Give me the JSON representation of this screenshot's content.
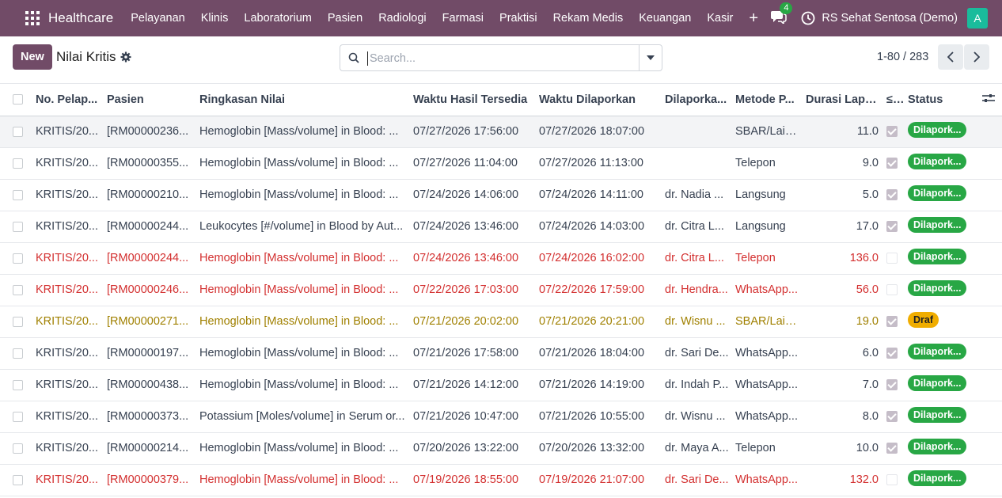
{
  "navbar": {
    "brand": "Healthcare",
    "menu": [
      "Pelayanan",
      "Klinis",
      "Laboratorium",
      "Pasien",
      "Radiologi",
      "Farmasi",
      "Praktisi",
      "Rekam Medis",
      "Keuangan",
      "Kasir"
    ],
    "plus": "+",
    "chat_count": "4",
    "company": "RS Sehat Sentosa (Demo)",
    "avatar_letter": "A",
    "colors": {
      "bar": "#714B67",
      "avatar": "#1ABC9C",
      "badge": "#28a745"
    }
  },
  "control": {
    "new_label": "New",
    "title": "Nilai Kritis",
    "search_placeholder": "Search...",
    "pager": "1-80 / 283"
  },
  "table": {
    "columns": [
      "No. Pelap...",
      "Pasien",
      "Ringkasan Nilai",
      "Waktu Hasil Tersedia",
      "Waktu Dilaporkan",
      "Dilaporka...",
      "Metode P...",
      "Durasi Lapo...",
      "≤...",
      "Status"
    ],
    "rows": [
      {
        "no": "KRITIS/20...",
        "pasien": "[RM00000236...",
        "ringkasan": "Hemoglobin [Mass/volume] in Blood: ...",
        "tersedia": "07/27/2026 17:56:00",
        "dilaporkan": "07/27/2026 18:07:00",
        "oleh": "",
        "metode": "SBAR/Lain...",
        "durasi": "11.0",
        "ok": true,
        "status": "Dilapork...",
        "tone": "normal",
        "status_kind": "green"
      },
      {
        "no": "KRITIS/20...",
        "pasien": "[RM00000355...",
        "ringkasan": "Hemoglobin [Mass/volume] in Blood: ...",
        "tersedia": "07/27/2026 11:04:00",
        "dilaporkan": "07/27/2026 11:13:00",
        "oleh": "",
        "metode": "Telepon",
        "durasi": "9.0",
        "ok": true,
        "status": "Dilapork...",
        "tone": "normal",
        "status_kind": "green"
      },
      {
        "no": "KRITIS/20...",
        "pasien": "[RM00000210...",
        "ringkasan": "Hemoglobin [Mass/volume] in Blood: ...",
        "tersedia": "07/24/2026 14:06:00",
        "dilaporkan": "07/24/2026 14:11:00",
        "oleh": "dr. Nadia ...",
        "metode": "Langsung",
        "durasi": "5.0",
        "ok": true,
        "status": "Dilapork...",
        "tone": "normal",
        "status_kind": "green"
      },
      {
        "no": "KRITIS/20...",
        "pasien": "[RM00000244...",
        "ringkasan": "Leukocytes [#/volume] in Blood by Aut...",
        "tersedia": "07/24/2026 13:46:00",
        "dilaporkan": "07/24/2026 14:03:00",
        "oleh": "dr. Citra L...",
        "metode": "Langsung",
        "durasi": "17.0",
        "ok": true,
        "status": "Dilapork...",
        "tone": "normal",
        "status_kind": "green"
      },
      {
        "no": "KRITIS/20...",
        "pasien": "[RM00000244...",
        "ringkasan": "Hemoglobin [Mass/volume] in Blood: ...",
        "tersedia": "07/24/2026 13:46:00",
        "dilaporkan": "07/24/2026 16:02:00",
        "oleh": "dr. Citra L...",
        "metode": "Telepon",
        "durasi": "136.0",
        "ok": false,
        "status": "Dilapork...",
        "tone": "red",
        "status_kind": "green"
      },
      {
        "no": "KRITIS/20...",
        "pasien": "[RM00000246...",
        "ringkasan": "Hemoglobin [Mass/volume] in Blood: ...",
        "tersedia": "07/22/2026 17:03:00",
        "dilaporkan": "07/22/2026 17:59:00",
        "oleh": "dr. Hendra...",
        "metode": "WhatsApp...",
        "durasi": "56.0",
        "ok": false,
        "status": "Dilapork...",
        "tone": "red",
        "status_kind": "green"
      },
      {
        "no": "KRITIS/20...",
        "pasien": "[RM00000271...",
        "ringkasan": "Hemoglobin [Mass/volume] in Blood: ...",
        "tersedia": "07/21/2026 20:02:00",
        "dilaporkan": "07/21/2026 20:21:00",
        "oleh": "dr. Wisnu ...",
        "metode": "SBAR/Lain...",
        "durasi": "19.0",
        "ok": true,
        "status": "Draf",
        "tone": "yellow",
        "status_kind": "orange"
      },
      {
        "no": "KRITIS/20...",
        "pasien": "[RM00000197...",
        "ringkasan": "Hemoglobin [Mass/volume] in Blood: ...",
        "tersedia": "07/21/2026 17:58:00",
        "dilaporkan": "07/21/2026 18:04:00",
        "oleh": "dr. Sari De...",
        "metode": "WhatsApp...",
        "durasi": "6.0",
        "ok": true,
        "status": "Dilapork...",
        "tone": "normal",
        "status_kind": "green"
      },
      {
        "no": "KRITIS/20...",
        "pasien": "[RM00000438...",
        "ringkasan": "Hemoglobin [Mass/volume] in Blood: ...",
        "tersedia": "07/21/2026 14:12:00",
        "dilaporkan": "07/21/2026 14:19:00",
        "oleh": "dr. Indah P...",
        "metode": "WhatsApp...",
        "durasi": "7.0",
        "ok": true,
        "status": "Dilapork...",
        "tone": "normal",
        "status_kind": "green"
      },
      {
        "no": "KRITIS/20...",
        "pasien": "[RM00000373...",
        "ringkasan": "Potassium [Moles/volume] in Serum or...",
        "tersedia": "07/21/2026 10:47:00",
        "dilaporkan": "07/21/2026 10:55:00",
        "oleh": "dr. Wisnu ...",
        "metode": "WhatsApp...",
        "durasi": "8.0",
        "ok": true,
        "status": "Dilapork...",
        "tone": "normal",
        "status_kind": "green"
      },
      {
        "no": "KRITIS/20...",
        "pasien": "[RM00000214...",
        "ringkasan": "Hemoglobin [Mass/volume] in Blood: ...",
        "tersedia": "07/20/2026 13:22:00",
        "dilaporkan": "07/20/2026 13:32:00",
        "oleh": "dr. Maya A...",
        "metode": "Telepon",
        "durasi": "10.0",
        "ok": true,
        "status": "Dilapork...",
        "tone": "normal",
        "status_kind": "green"
      },
      {
        "no": "KRITIS/20...",
        "pasien": "[RM00000379...",
        "ringkasan": "Hemoglobin [Mass/volume] in Blood: ...",
        "tersedia": "07/19/2026 18:55:00",
        "dilaporkan": "07/19/2026 21:07:00",
        "oleh": "dr. Sari De...",
        "metode": "WhatsApp...",
        "durasi": "132.0",
        "ok": false,
        "status": "Dilapork...",
        "tone": "red",
        "status_kind": "green"
      }
    ]
  }
}
